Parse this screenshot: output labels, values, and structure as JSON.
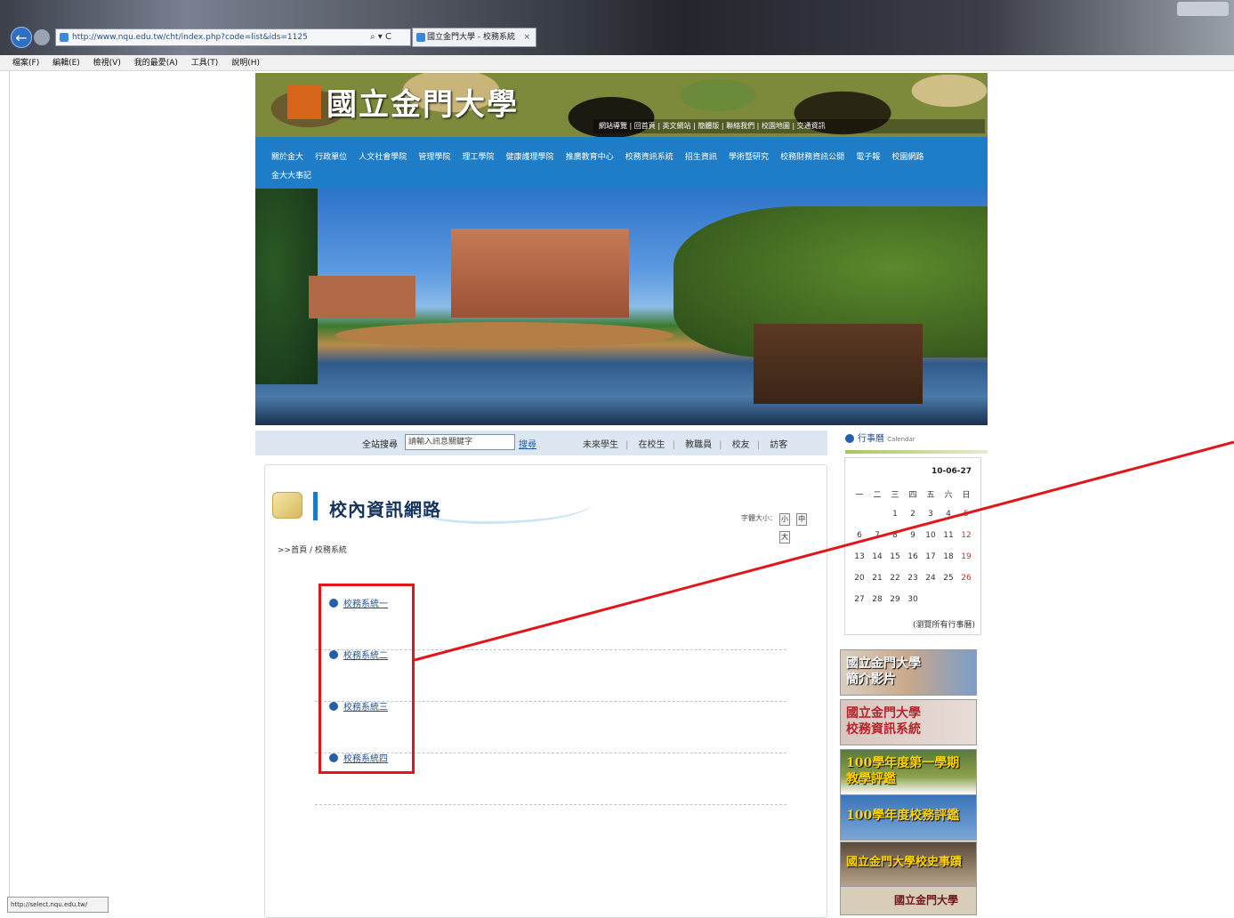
{
  "browser": {
    "address": "http://www.nqu.edu.tw/cht/index.php?code=list&ids=1125",
    "address_tools": "⌕ ▾ C",
    "tab_title": "國立金門大學 - 校務系統",
    "tab_close": "×",
    "menu": [
      "檔案(F)",
      "編輯(E)",
      "檢視(V)",
      "我的最愛(A)",
      "工具(T)",
      "說明(H)"
    ],
    "status_url": "http://select.nqu.edu.tw/"
  },
  "site": {
    "logo_text": "國立金門大學",
    "banner_links": "網站導覽 | 回首頁 | 英文網站 | 簡體版 | 聯絡我們 | 校園地圖 | 交通資訊",
    "nav": [
      "關於金大",
      "行政單位",
      "人文社會學院",
      "管理學院",
      "理工學院",
      "健康護理學院",
      "推廣教育中心",
      "校務資訊系統",
      "招生資訊",
      "學術暨研究",
      "校務財務資訊公開",
      "電子報",
      "校園網路",
      "金大大事記"
    ],
    "search_label": "全站搜尋",
    "search_placeholder": "請輸入訊息關鍵字",
    "search_go": "搜尋",
    "quick_links": [
      "未來學生",
      "在校生",
      "教職員",
      "校友",
      "訪客"
    ]
  },
  "content": {
    "title": "校內資訊網路",
    "font_size_label": "字體大小：",
    "font_sizes": [
      "小",
      "中",
      "大"
    ],
    "breadcrumb": ">>首頁 / 校務系統",
    "links": [
      "校務系統一",
      "校務系統二",
      "校務系統三",
      "校務系統四"
    ]
  },
  "calendar": {
    "title": "行事曆",
    "title_en": "Calendar",
    "date": "10-06-27",
    "weekdays": [
      "一",
      "二",
      "三",
      "四",
      "五",
      "六",
      "日"
    ],
    "weeks": [
      [
        "",
        "",
        "1",
        "2",
        "3",
        "4",
        "5"
      ],
      [
        "6",
        "7",
        "8",
        "9",
        "10",
        "11",
        "12"
      ],
      [
        "13",
        "14",
        "15",
        "16",
        "17",
        "18",
        "19"
      ],
      [
        "20",
        "21",
        "22",
        "23",
        "24",
        "25",
        "26"
      ],
      [
        "27",
        "28",
        "29",
        "30",
        "",
        "",
        ""
      ]
    ],
    "more": "(瀏覽所有行事曆)"
  },
  "side_banners": [
    "國立金門大學\n簡介影片",
    "國立金門大學\n校務資訊系統",
    "100學年度第一學期\n教學評鑑",
    "100學年度校務評鑑",
    "國立金門大學校史事蹟",
    "國立金門大學"
  ],
  "colors": {
    "nav": "#1f7cc6",
    "highlight": "#e0161b",
    "link": "#1f4f8a"
  }
}
